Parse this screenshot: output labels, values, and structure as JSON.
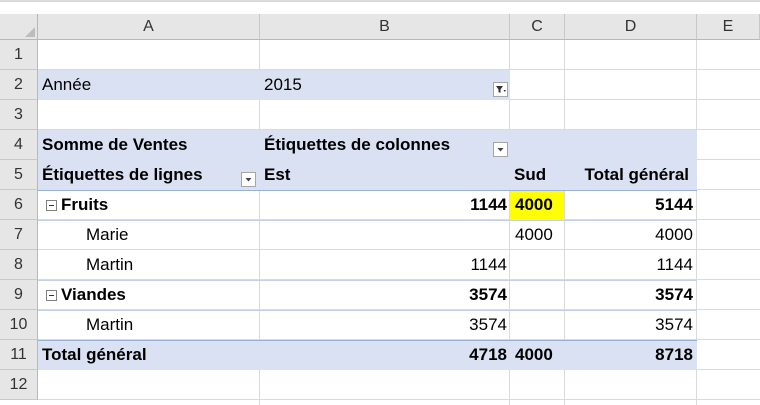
{
  "columns": [
    "A",
    "B",
    "C",
    "D",
    "E"
  ],
  "rows": [
    "1",
    "2",
    "3",
    "4",
    "5",
    "6",
    "7",
    "8",
    "9",
    "10",
    "11",
    "12"
  ],
  "filter": {
    "label": "Année",
    "value": "2015"
  },
  "pivot": {
    "values_label": "Somme de Ventes",
    "col_labels": "Étiquettes de colonnes",
    "row_labels": "Étiquettes de lignes",
    "col_headers": [
      "Est",
      "Sud",
      "Total général"
    ],
    "body": [
      {
        "label": "Fruits",
        "level": 0,
        "est": "1144",
        "sud": "4000",
        "total": "5144"
      },
      {
        "label": "Marie",
        "level": 1,
        "est": "",
        "sud": "4000",
        "total": "4000"
      },
      {
        "label": "Martin",
        "level": 1,
        "est": "1144",
        "sud": "",
        "total": "1144"
      },
      {
        "label": "Viandes",
        "level": 0,
        "est": "3574",
        "sud": "",
        "total": "3574"
      },
      {
        "label": "Martin",
        "level": 1,
        "est": "3574",
        "sud": "",
        "total": "3574"
      }
    ],
    "grand_total": {
      "label": "Total général",
      "est": "4718",
      "sud": "4000",
      "total": "8718"
    }
  },
  "highlight_color": "#ffff00",
  "accent_color": "#d9e1f2"
}
